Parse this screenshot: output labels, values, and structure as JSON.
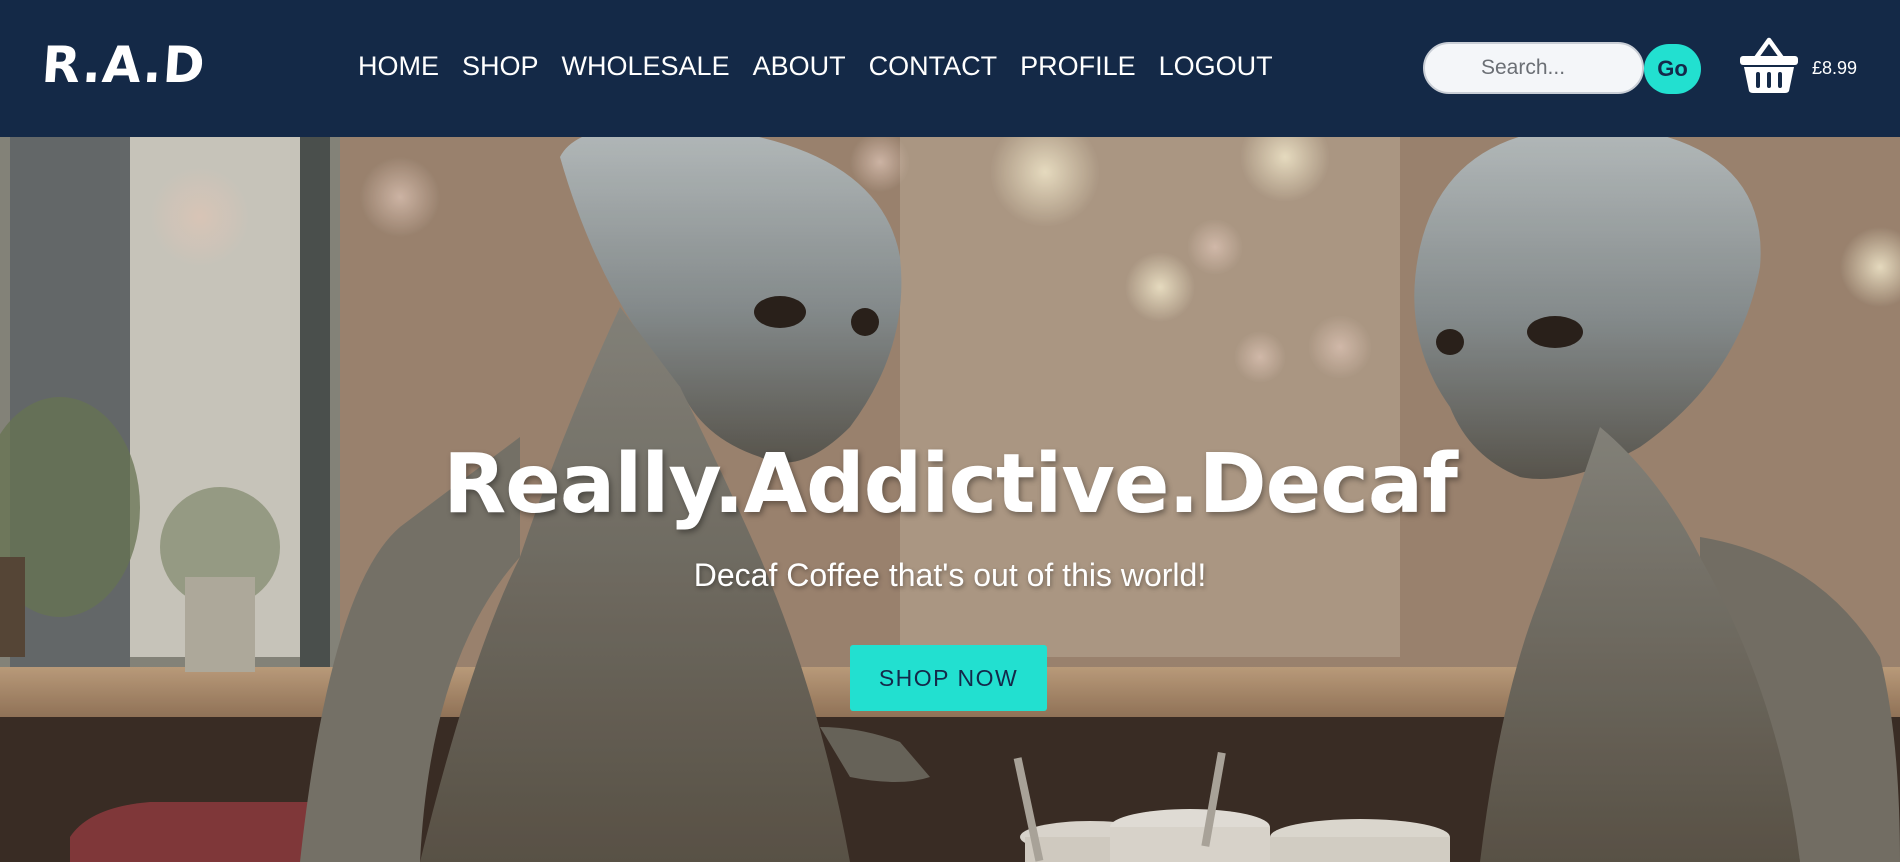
{
  "header": {
    "logo_text": "R.A.D",
    "nav": [
      {
        "label": "HOME"
      },
      {
        "label": "SHOP"
      },
      {
        "label": "WHOLESALE"
      },
      {
        "label": "ABOUT"
      },
      {
        "label": "CONTACT"
      },
      {
        "label": "PROFILE"
      },
      {
        "label": "LOGOUT"
      }
    ],
    "search": {
      "placeholder": "Search...",
      "value": "",
      "button_label": "Go"
    },
    "cart": {
      "icon": "basket-icon",
      "total": "£8.99"
    }
  },
  "hero": {
    "title": "Really.Addictive.Decaf",
    "subtitle": "Decaf Coffee that's out of this world!",
    "cta_label": "SHOP NOW",
    "background": "alien-cafe-photo"
  },
  "colors": {
    "header_bg": "#142947",
    "accent": "#22e0d0",
    "text_light": "#ffffff"
  }
}
